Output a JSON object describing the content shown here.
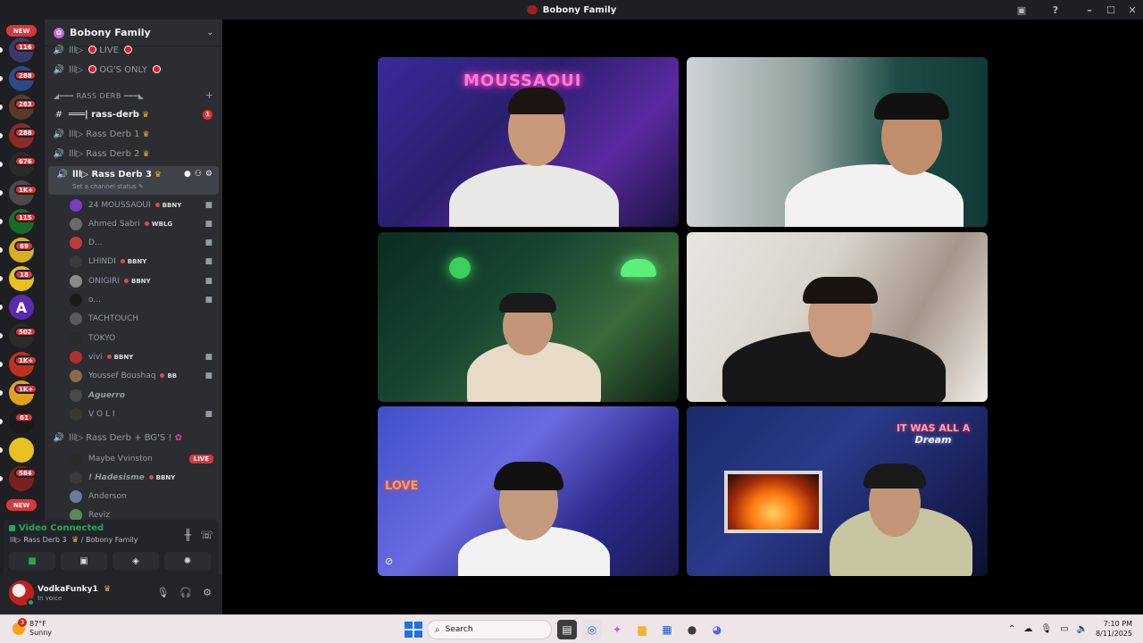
{
  "window": {
    "title": "Bobony Family"
  },
  "rail": {
    "top_badge": "NEW",
    "badges": [
      "116",
      "288",
      "263",
      "288",
      "676",
      "1K+",
      "115",
      "69",
      "18",
      "502",
      "1K+",
      "1K+",
      "61",
      "584"
    ],
    "bottom_badge": "NEW",
    "letter": "A"
  },
  "server": {
    "name": "Bobony Family"
  },
  "channels": {
    "live": "LIVE",
    "og_only": "OG'S ONLY",
    "category": "◢━━━ RASS DERB ━━━◣",
    "text_channel": "rass-derb",
    "text_count": "1",
    "derb1": "Rass Derb 1",
    "derb2": "Rass Derb 2",
    "derb3": "Rass Derb 3",
    "status_prompt": "Set a channel status",
    "derb_bgs": "Rass Derb + BG'S !"
  },
  "voice_users": [
    {
      "name": "24 MOUSSAOUI",
      "tag": "BBNY",
      "color": "#7a3cc0"
    },
    {
      "name": "Ahmed Sabri",
      "tag": "WBLG",
      "color": "#6a6a6a"
    },
    {
      "name": "D...",
      "tag": "",
      "color": "#c03a3a"
    },
    {
      "name": "LHINDI",
      "tag": "BBNY",
      "color": "#3a3a3a"
    },
    {
      "name": "ONIGIRI",
      "tag": "BBNY",
      "color": "#8a8a8a"
    },
    {
      "name": "o...",
      "tag": "",
      "color": "#1a1a1a"
    },
    {
      "name": "TACHTOUCH",
      "tag": "",
      "color": "#5a5a5a"
    },
    {
      "name": "TOKYO",
      "tag": "",
      "color": "#2a2a2a"
    },
    {
      "name": "vivi",
      "tag": "BBNY",
      "color": "#b03030"
    },
    {
      "name": "Youssef Boushaq",
      "tag": "BB",
      "color": "#8a6a4a"
    },
    {
      "name": "Aguerro",
      "tag": "",
      "color": "#4a4a4a"
    },
    {
      "name": "V O L I",
      "tag": "",
      "color": "#3a3a2a"
    }
  ],
  "bgs_users": [
    {
      "name": "Maybe Vvinston",
      "tag": "",
      "color": "#2a2a2a",
      "live": "LIVE"
    },
    {
      "name": "! Hadesisme",
      "tag": "BBNY",
      "color": "#3a3a3a",
      "live": ""
    },
    {
      "name": "Anderson",
      "tag": "",
      "color": "#6a7a9a",
      "live": ""
    },
    {
      "name": "Reviz",
      "tag": "",
      "color": "#5a8a5a",
      "live": ""
    }
  ],
  "voice_panel": {
    "status": "Video Connected",
    "channel": "Rass Derb 3",
    "server": "/ Bobony Family"
  },
  "user": {
    "name": "VodkaFunky1",
    "status": "In voice"
  },
  "video": {
    "neon_top_left": "MOUSSAOUI",
    "neon_bottom_left": "LOVE",
    "neon_bottom_right_line1": "IT WAS ALL A",
    "neon_bottom_right_line2": "Dream"
  },
  "taskbar": {
    "temp": "87°F",
    "weather": "Sunny",
    "weather_badge": "3",
    "search_placeholder": "Search",
    "time": "7:10 PM",
    "date": "8/11/2025"
  }
}
